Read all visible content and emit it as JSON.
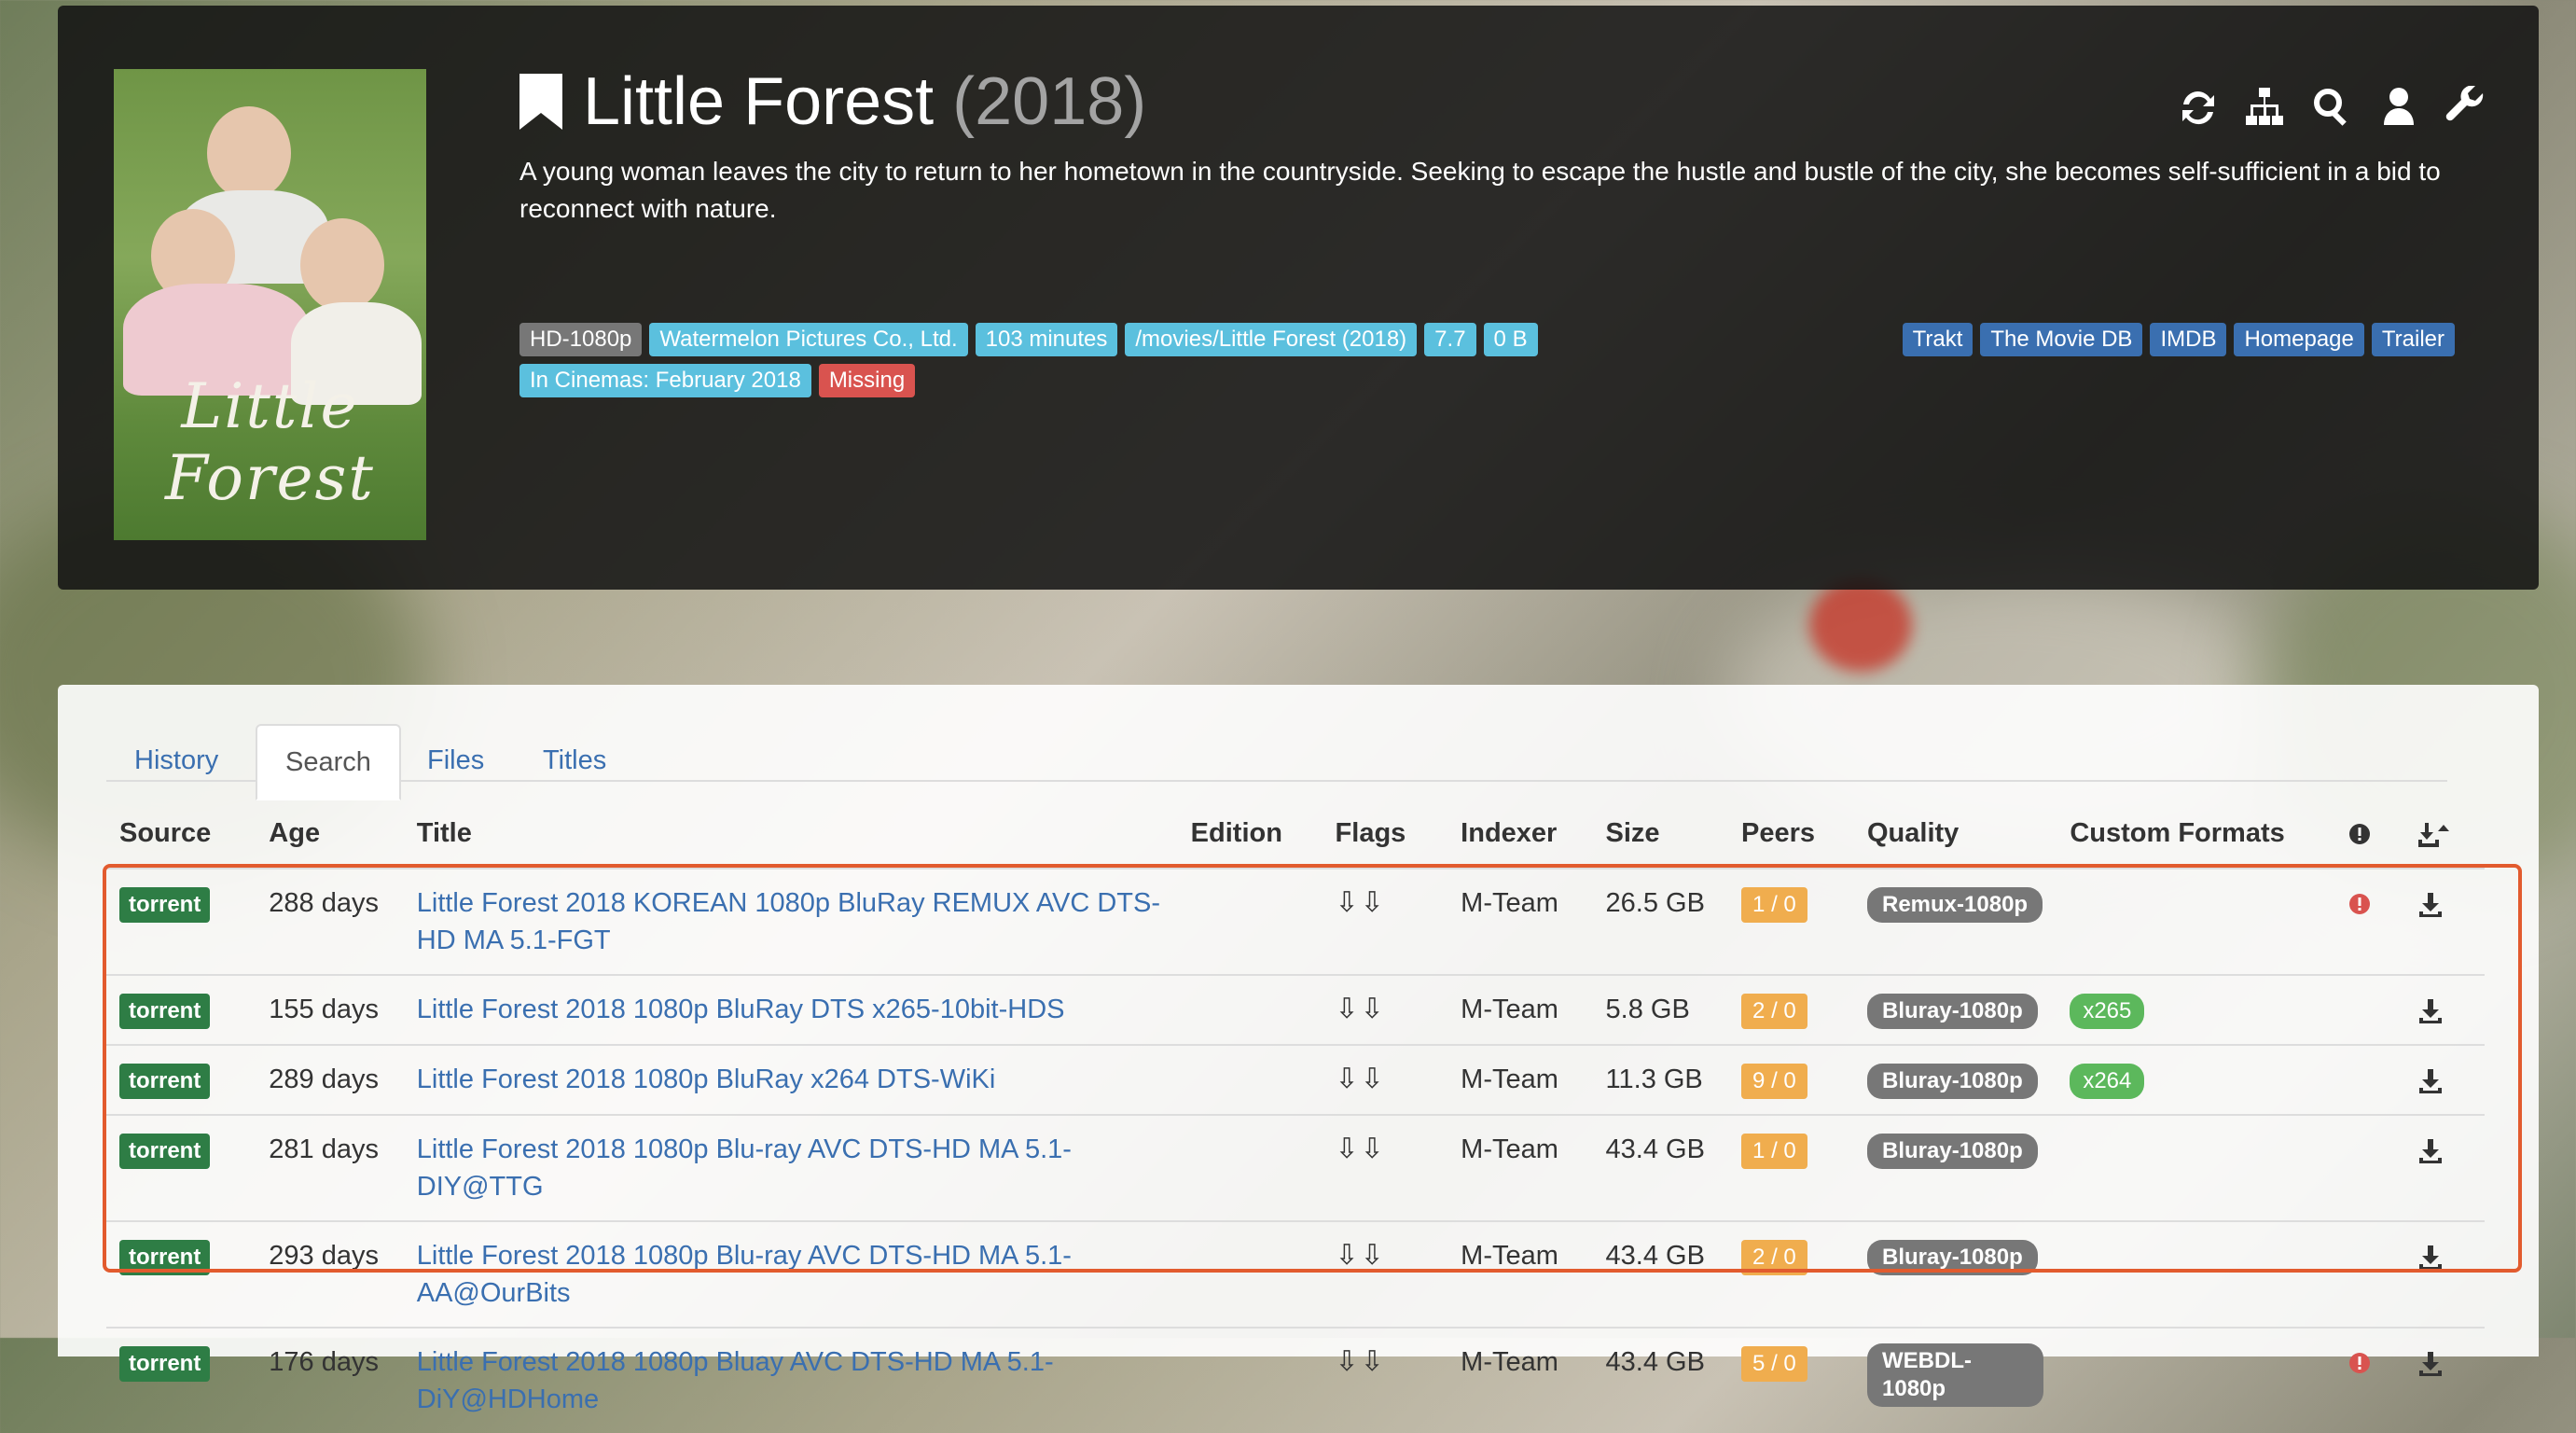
{
  "movie": {
    "title": "Little Forest",
    "year": "(2018)",
    "poster_title": "Little Forest",
    "overview": "A young woman leaves the city to return to her hometown in the countryside. Seeking to escape the hustle and bustle of the city, she becomes self-sufficient in a bid to reconnect with nature."
  },
  "actions": [
    "refresh-icon",
    "sitemap-icon",
    "search-icon",
    "user-icon",
    "wrench-icon"
  ],
  "tags": [
    {
      "text": "HD-1080p",
      "style": "gray"
    },
    {
      "text": "Watermelon Pictures Co., Ltd.",
      "style": "info"
    },
    {
      "text": "103 minutes",
      "style": "info"
    },
    {
      "text": "/movies/Little Forest (2018)",
      "style": "info"
    },
    {
      "text": "7.7",
      "style": "info"
    },
    {
      "text": "0 B",
      "style": "info"
    },
    {
      "text": "In Cinemas: February 2018",
      "style": "info"
    },
    {
      "text": "Missing",
      "style": "danger"
    }
  ],
  "links": [
    "Trakt",
    "The Movie DB",
    "IMDB",
    "Homepage",
    "Trailer"
  ],
  "tabs": [
    {
      "label": "History",
      "active": false
    },
    {
      "label": "Search",
      "active": true
    },
    {
      "label": "Files",
      "active": false
    },
    {
      "label": "Titles",
      "active": false
    }
  ],
  "columns": {
    "source": "Source",
    "age": "Age",
    "title": "Title",
    "edition": "Edition",
    "flags": "Flags",
    "indexer": "Indexer",
    "size": "Size",
    "peers": "Peers",
    "quality": "Quality",
    "custom_formats": "Custom Formats"
  },
  "colors": {
    "accent": "#3a6fb0",
    "torrent": "#2e7d45",
    "peers": "#f0ad4e",
    "highlight": "#e25b2e"
  },
  "rows": [
    {
      "source": "torrent",
      "age": "288 days",
      "title": "Little Forest 2018 KOREAN 1080p BluRay REMUX AVC DTS-HD MA 5.1-FGT",
      "edition": "",
      "flags": "⇩⇩",
      "indexer": "M-Team",
      "size": "26.5 GB",
      "peers": "1 / 0",
      "quality": "Remux-1080p",
      "custom_format": "",
      "rejected": true
    },
    {
      "source": "torrent",
      "age": "155 days",
      "title": "Little Forest 2018 1080p BluRay DTS x265-10bit-HDS",
      "edition": "",
      "flags": "⇩⇩",
      "indexer": "M-Team",
      "size": "5.8 GB",
      "peers": "2 / 0",
      "quality": "Bluray-1080p",
      "custom_format": "x265",
      "rejected": false
    },
    {
      "source": "torrent",
      "age": "289 days",
      "title": "Little Forest 2018 1080p BluRay x264 DTS-WiKi",
      "edition": "",
      "flags": "⇩⇩",
      "indexer": "M-Team",
      "size": "11.3 GB",
      "peers": "9 / 0",
      "quality": "Bluray-1080p",
      "custom_format": "x264",
      "rejected": false
    },
    {
      "source": "torrent",
      "age": "281 days",
      "title": "Little Forest 2018 1080p Blu-ray AVC DTS-HD MA 5.1-DIY@TTG",
      "edition": "",
      "flags": "⇩⇩",
      "indexer": "M-Team",
      "size": "43.4 GB",
      "peers": "1 / 0",
      "quality": "Bluray-1080p",
      "custom_format": "",
      "rejected": false
    },
    {
      "source": "torrent",
      "age": "293 days",
      "title": "Little Forest 2018 1080p Blu-ray AVC DTS-HD MA 5.1-AA@OurBits",
      "edition": "",
      "flags": "⇩⇩",
      "indexer": "M-Team",
      "size": "43.4 GB",
      "peers": "2 / 0",
      "quality": "Bluray-1080p",
      "custom_format": "",
      "rejected": false
    },
    {
      "source": "torrent",
      "age": "176 days",
      "title": "Little Forest 2018 1080p Bluay AVC DTS-HD MA 5.1-DiY@HDHome",
      "edition": "",
      "flags": "⇩⇩",
      "indexer": "M-Team",
      "size": "43.4 GB",
      "peers": "5 / 0",
      "quality": "WEBDL-1080p",
      "custom_format": "",
      "rejected": true
    }
  ]
}
